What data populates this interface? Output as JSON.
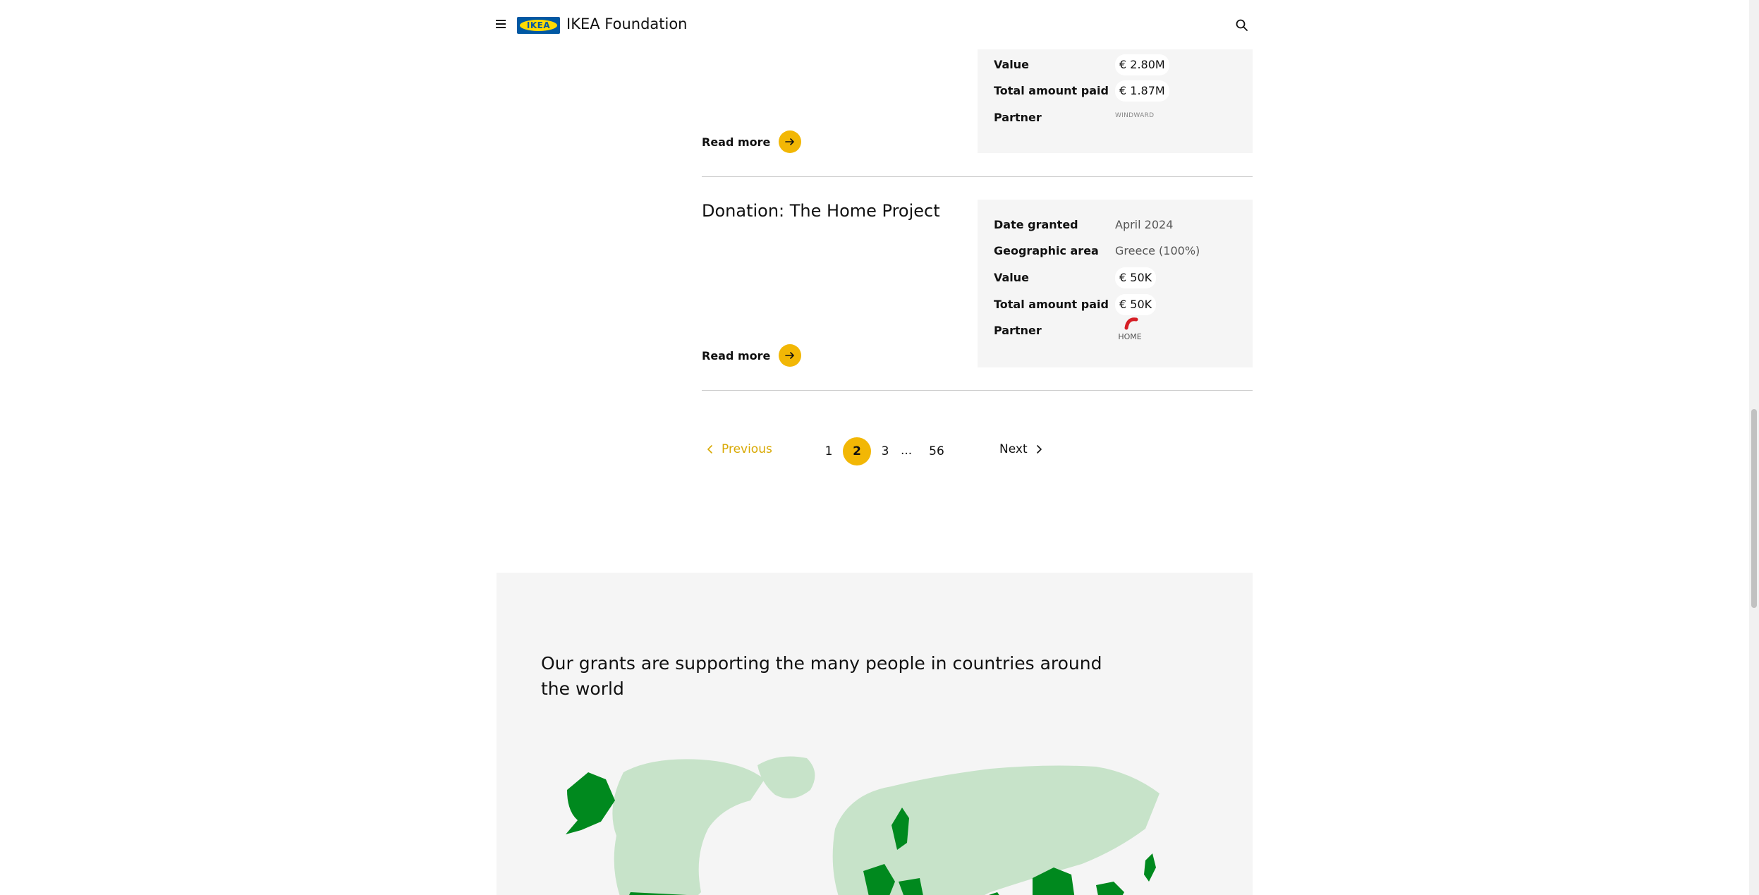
{
  "header": {
    "brand_logo_text": "IKEA",
    "brand_name": "IKEA Foundation"
  },
  "grants": [
    {
      "details": [
        {
          "label": "Value",
          "value": "€ 2.80M"
        },
        {
          "label": "Total amount paid",
          "value": "€ 1.87M"
        },
        {
          "label": "Partner",
          "value": "WINDWARD"
        }
      ],
      "read_more": "Read more"
    },
    {
      "title": "Donation: The Home Project",
      "details": [
        {
          "label": "Date granted",
          "value": "April 2024"
        },
        {
          "label": "Geographic area",
          "value": "Greece (100%)"
        },
        {
          "label": "Value",
          "value": "€ 50K"
        },
        {
          "label": "Total amount paid",
          "value": "€ 50K"
        },
        {
          "label": "Partner",
          "value": "HOME"
        }
      ],
      "read_more": "Read more"
    }
  ],
  "pagination": {
    "previous": "Previous",
    "pages": [
      "1",
      "2",
      "3",
      "56"
    ],
    "current": "2",
    "ellipsis": "...",
    "next": "Next"
  },
  "map_section": {
    "heading": "Our grants are supporting the many people in countries around the world"
  },
  "colors": {
    "accent_yellow": "#f2b705",
    "ikea_blue": "#0058a3",
    "ikea_yellow": "#ffdb00",
    "map_land": "#c7e3c9",
    "map_highlight": "#00891e"
  },
  "icons": {
    "menu": "hamburger-menu-icon",
    "search": "search-icon",
    "arrow_right": "arrow-right-icon",
    "chevron_left": "chevron-left-icon",
    "chevron_right": "chevron-right-icon"
  }
}
